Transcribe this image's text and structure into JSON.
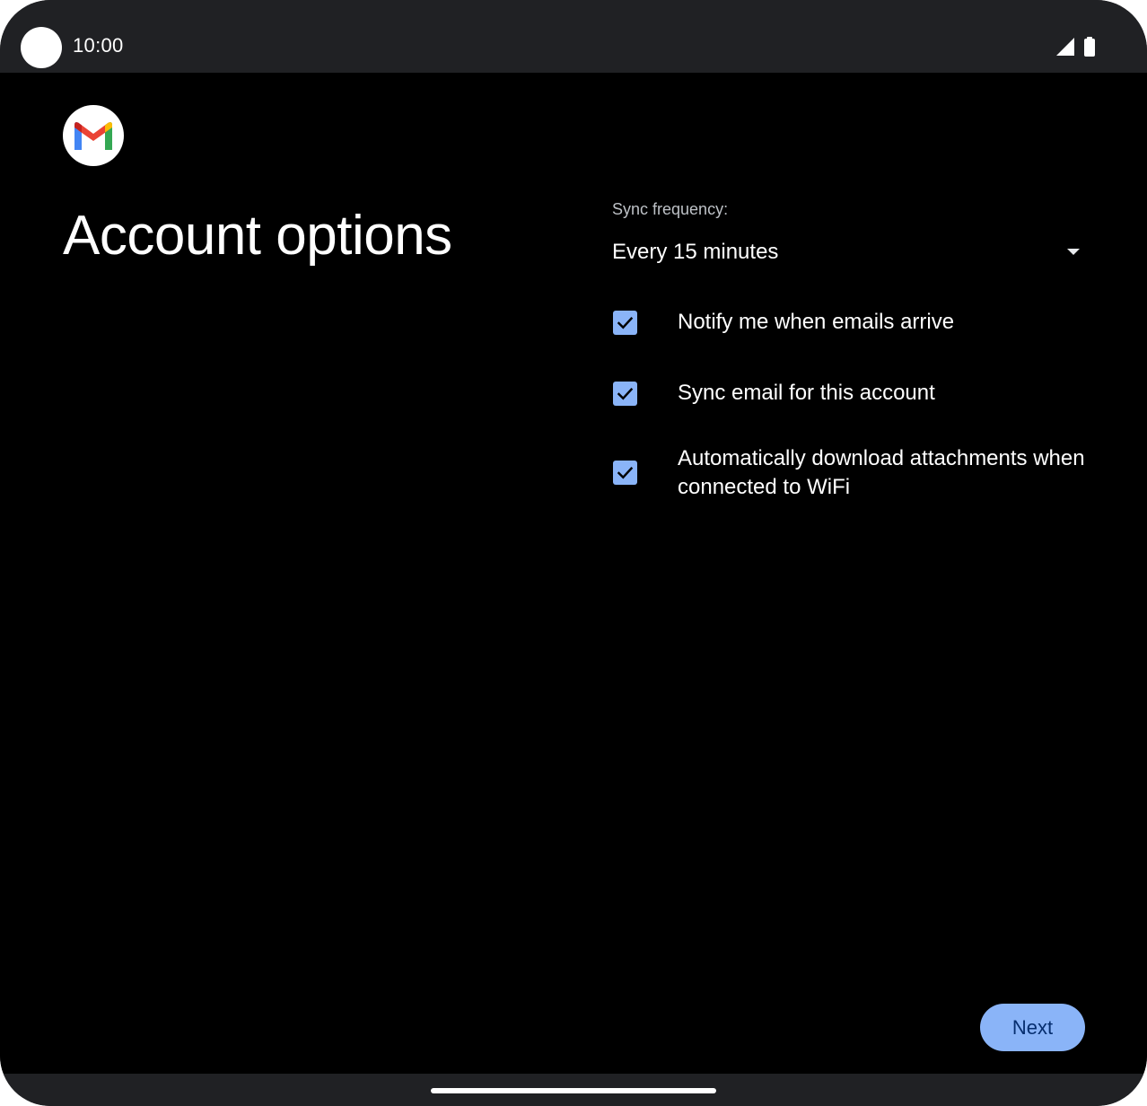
{
  "status_bar": {
    "time": "10:00",
    "icons": [
      "signal-icon",
      "battery-icon"
    ]
  },
  "app": {
    "logo_icon": "gmail-logo-icon",
    "title": "Account options"
  },
  "sync": {
    "label": "Sync frequency:",
    "value": "Every 15 minutes"
  },
  "options": [
    {
      "label": "Notify me when emails arrive",
      "checked": true
    },
    {
      "label": "Sync email for this account",
      "checked": true
    },
    {
      "label": "Automatically download attachments when connected to WiFi",
      "checked": true
    }
  ],
  "actions": {
    "next_label": "Next"
  },
  "colors": {
    "accent": "#8ab4f8",
    "background": "#000000",
    "system_bar": "#202124",
    "button_text": "#062e6f"
  }
}
